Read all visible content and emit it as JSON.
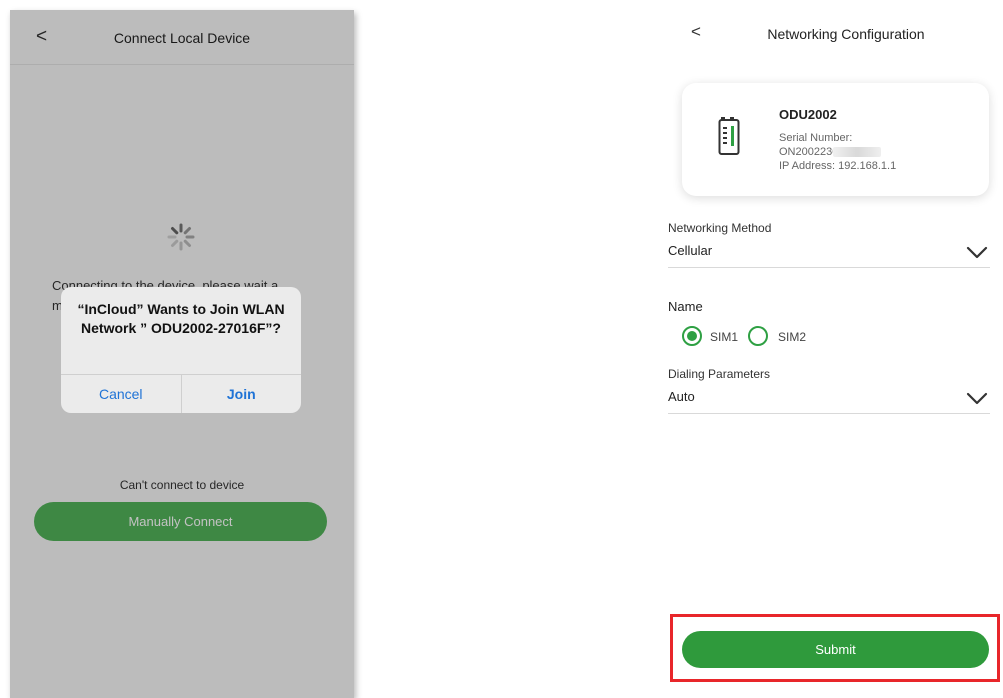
{
  "left_screen": {
    "header": {
      "back_glyph": "<",
      "title": "Connect Local Device"
    },
    "connecting_text": "Connecting to the device, please wait a moment...",
    "cant_connect_text": "Can't connect to device",
    "manual_connect_label": "Manually Connect",
    "alert": {
      "title": "“InCloud” Wants to Join WLAN Network ” ODU2002-27016F”?",
      "cancel_label": "Cancel",
      "join_label": "Join"
    },
    "spinner_icon": "loading-spinner-icon"
  },
  "right_screen": {
    "header": {
      "back_glyph": "<",
      "title": "Networking Configuration"
    },
    "device": {
      "name": "ODU2002",
      "serial_label": "Serial Number:",
      "serial_value": "ON2002230",
      "ip": "IP Address: 192.168.1.1",
      "icon": "router-device-icon"
    },
    "networking_method": {
      "label": "Networking Method",
      "value": "Cellular"
    },
    "name_field": {
      "label": "Name",
      "options": [
        {
          "label": "SIM1",
          "selected": true
        },
        {
          "label": "SIM2",
          "selected": false
        }
      ]
    },
    "dialing_parameters": {
      "label": "Dialing Parameters",
      "value": "Auto"
    },
    "submit_label": "Submit"
  },
  "colors": {
    "accent_green": "#2f9a3c",
    "manual_button_green": "#52b35a",
    "ios_blue": "#1f73d6",
    "highlight_red": "#e8262a"
  }
}
